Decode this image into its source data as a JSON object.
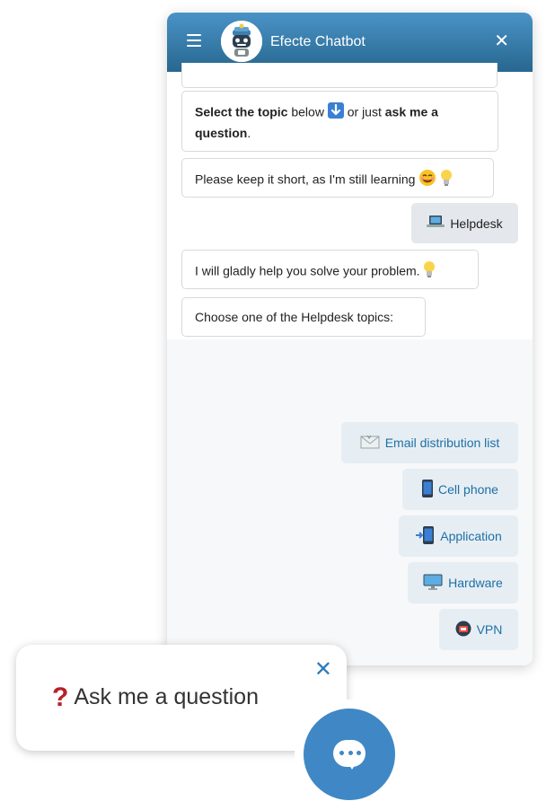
{
  "header": {
    "title": "Efecte Chatbot",
    "menu_icon": "hamburger-icon",
    "close_icon": "close-icon",
    "avatar_icon": "robot-avatar-icon"
  },
  "messages": {
    "topic_prefix": "Select the topic",
    "topic_mid": "below",
    "topic_mid2": "or just",
    "topic_strong": "ask me a question",
    "topic_suffix": ".",
    "keep_short": "Please keep it short, as I'm still learning",
    "user_choice": "Helpdesk",
    "gladly": "I will gladly help you solve your problem.",
    "choose": "Choose one of the Helpdesk topics:"
  },
  "options": [
    {
      "label": "Email distribution list",
      "icon": "envelope-icon"
    },
    {
      "label": "Cell phone",
      "icon": "mobile-phone-icon"
    },
    {
      "label": "Application",
      "icon": "app-enter-icon"
    },
    {
      "label": "Hardware",
      "icon": "monitor-icon"
    },
    {
      "label": "VPN",
      "icon": "vpn-shield-icon"
    }
  ],
  "ask_popup": {
    "text": "Ask me a question",
    "question_mark": "?",
    "close_symbol": "✕"
  },
  "colors": {
    "header_top": "#4a93c7",
    "header_bottom": "#27678f",
    "option_text": "#1f6fa4",
    "launcher": "#3f88c5",
    "question_mark": "#b8202a"
  }
}
